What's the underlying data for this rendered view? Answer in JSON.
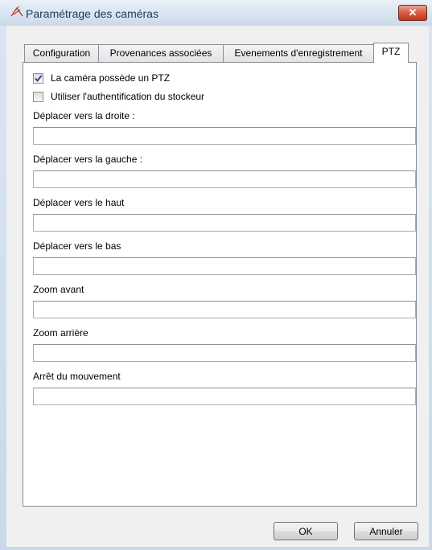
{
  "window": {
    "title": "Paramétrage des caméras",
    "close_symbol": "✕"
  },
  "tabs": [
    {
      "label": "Configuration",
      "active": false
    },
    {
      "label": "Provenances associées",
      "active": false
    },
    {
      "label": "Evenements d'enregistrement",
      "active": false
    },
    {
      "label": "PTZ",
      "active": true
    }
  ],
  "ptz": {
    "has_ptz": {
      "label": "La caméra possède un PTZ",
      "checked": true
    },
    "use_auth": {
      "label": "Utiliser l'authentification du stockeur",
      "checked": false
    },
    "fields": [
      {
        "label": "Déplacer vers la droite :",
        "value": ""
      },
      {
        "label": "Déplacer vers la gauche :",
        "value": ""
      },
      {
        "label": "Déplacer vers le haut",
        "value": ""
      },
      {
        "label": "Déplacer vers le bas",
        "value": ""
      },
      {
        "label": "Zoom avant",
        "value": ""
      },
      {
        "label": "Zoom arrière",
        "value": ""
      },
      {
        "label": "Arrêt du mouvement",
        "value": ""
      }
    ]
  },
  "buttons": {
    "ok": "OK",
    "cancel": "Annuler"
  }
}
